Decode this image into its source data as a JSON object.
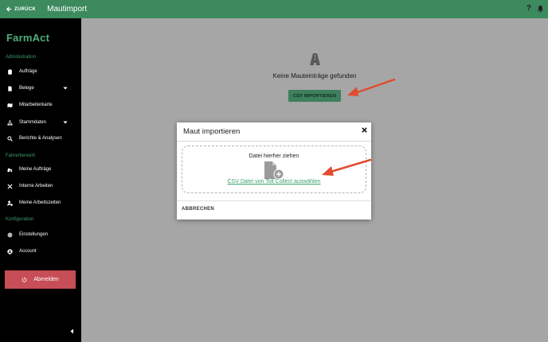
{
  "topbar": {
    "back_label": "ZURÜCK",
    "title": "Mautimport",
    "help_label": "?",
    "color": "#3c8a5e"
  },
  "sidebar": {
    "brand": "FarmAct",
    "sections": {
      "administration": "Administration",
      "fahrerbereich": "Fahrerbereich",
      "konfiguration": "Konfiguration"
    },
    "items": [
      {
        "label": "Aufträge",
        "icon": "clipboard-icon"
      },
      {
        "label": "Belege",
        "icon": "document-icon",
        "expandable": true
      },
      {
        "label": "Mitarbeiterkarte",
        "icon": "map-icon"
      },
      {
        "label": "Stammdaten",
        "icon": "hierarchy-icon",
        "expandable": true
      },
      {
        "label": "Berichte & Analysen",
        "icon": "search-icon"
      },
      {
        "label": "Meine Aufträge",
        "icon": "tractor-icon"
      },
      {
        "label": "Interne Arbeiten",
        "icon": "tools-icon"
      },
      {
        "label": "Meine Arbeitszeiten",
        "icon": "user-clock-icon"
      },
      {
        "label": "Einstellungen",
        "icon": "gear-icon"
      },
      {
        "label": "Account",
        "icon": "account-icon"
      }
    ],
    "logout_label": "Abmelden",
    "logout_color": "#c74d56"
  },
  "main": {
    "empty_text": "Keine Mauteinträge gefunden",
    "csv_button": "CSV IMPORTIEREN"
  },
  "modal": {
    "title": "Maut importieren",
    "drop_hint": "Datei hierher ziehen",
    "link_text": "CSV Datei von Toll Collect auswählen",
    "cancel_label": "ABBRECHEN"
  }
}
